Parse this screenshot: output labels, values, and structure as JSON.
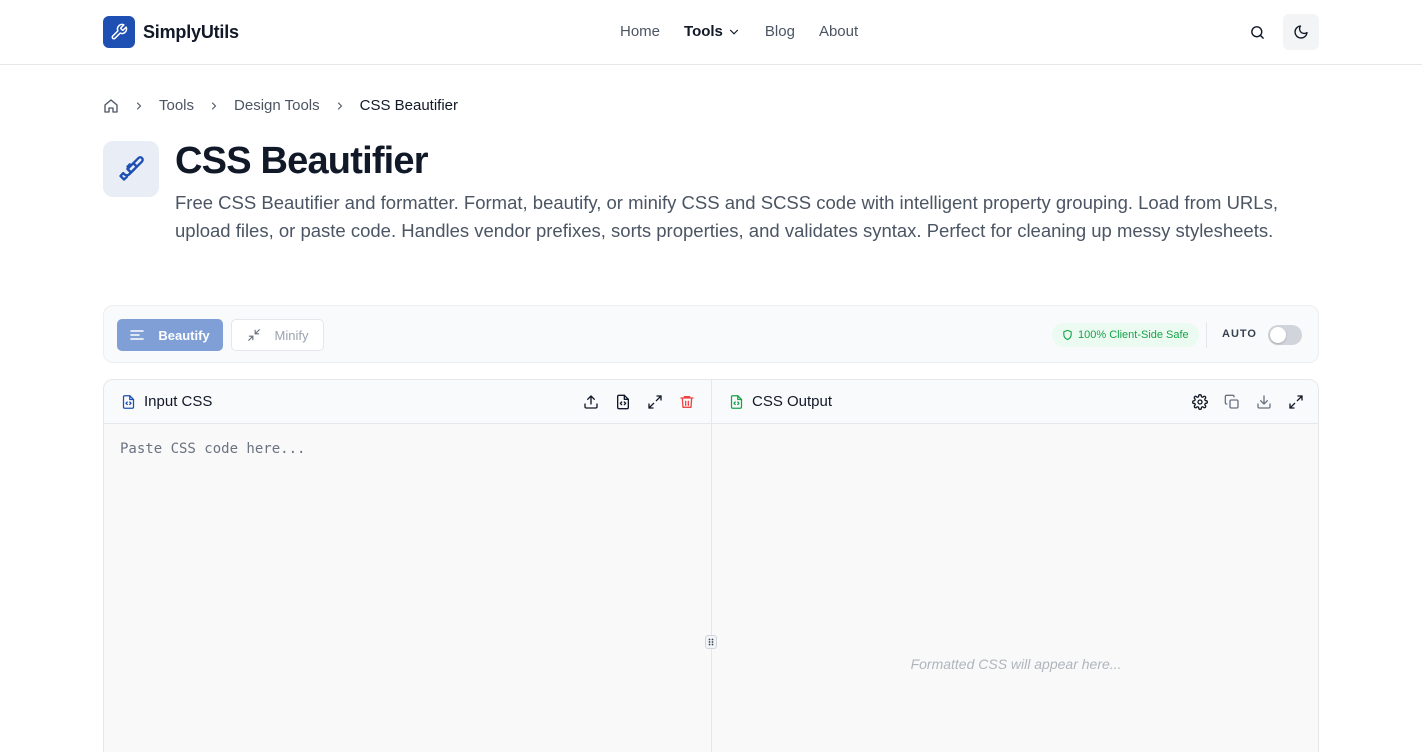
{
  "header": {
    "brand": "SimplyUtils",
    "nav": [
      {
        "label": "Home"
      },
      {
        "label": "Tools"
      },
      {
        "label": "Blog"
      },
      {
        "label": "About"
      }
    ],
    "icons": {
      "search": "search-icon",
      "theme": "moon-icon"
    }
  },
  "breadcrumb": {
    "items": [
      "Tools",
      "Design Tools",
      "CSS Beautifier"
    ]
  },
  "page": {
    "title": "CSS Beautifier",
    "description": "Free CSS Beautifier and formatter. Format, beautify, or minify CSS and SCSS code with intelligent property grouping. Load from URLs, upload files, or paste code. Handles vendor prefixes, sorts properties, and validates syntax. Perfect for cleaning up messy stylesheets."
  },
  "toolbar": {
    "beautify_label": "Beautify",
    "minify_label": "Minify",
    "safe_badge": "100% Client-Side Safe",
    "auto_label": "AUTO",
    "auto_enabled": false
  },
  "input_pane": {
    "title": "Input CSS",
    "placeholder": "Paste CSS code here..."
  },
  "output_pane": {
    "title": "CSS Output",
    "placeholder": "Formatted CSS will appear here..."
  },
  "colors": {
    "brand": "#1e4fb3",
    "primary_button": "#7f9fd6",
    "safe_green": "#16a34a",
    "delete_red": "#ef4444"
  }
}
